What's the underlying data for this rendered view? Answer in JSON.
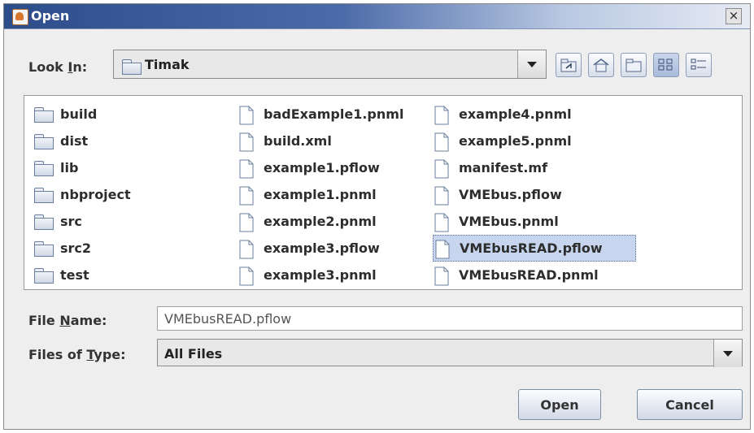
{
  "window": {
    "title": "Open",
    "close_glyph": "×"
  },
  "lookin": {
    "label_prefix": "Look ",
    "label_mnemonic": "I",
    "label_suffix": "n:",
    "value": "Timak",
    "icon": "folder-icon"
  },
  "toolbar": {
    "buttons": [
      {
        "name": "up-one-level-icon"
      },
      {
        "name": "home-icon"
      },
      {
        "name": "new-folder-icon"
      },
      {
        "name": "list-view-icon",
        "pressed": true
      },
      {
        "name": "details-view-icon"
      }
    ]
  },
  "files": {
    "col1": [
      {
        "name": "build",
        "type": "folder"
      },
      {
        "name": "dist",
        "type": "folder"
      },
      {
        "name": "lib",
        "type": "folder"
      },
      {
        "name": "nbproject",
        "type": "folder"
      },
      {
        "name": "src",
        "type": "folder"
      },
      {
        "name": "src2",
        "type": "folder"
      },
      {
        "name": "test",
        "type": "folder"
      }
    ],
    "col2": [
      {
        "name": "badExample1.pnml",
        "type": "file"
      },
      {
        "name": "build.xml",
        "type": "file"
      },
      {
        "name": "example1.pflow",
        "type": "file"
      },
      {
        "name": "example1.pnml",
        "type": "file"
      },
      {
        "name": "example2.pnml",
        "type": "file"
      },
      {
        "name": "example3.pflow",
        "type": "file"
      },
      {
        "name": "example3.pnml",
        "type": "file"
      }
    ],
    "col3": [
      {
        "name": "example4.pnml",
        "type": "file"
      },
      {
        "name": "example5.pnml",
        "type": "file"
      },
      {
        "name": "manifest.mf",
        "type": "file"
      },
      {
        "name": "VMEbus.pflow",
        "type": "file"
      },
      {
        "name": "VMEbus.pnml",
        "type": "file"
      },
      {
        "name": "VMEbusREAD.pflow",
        "type": "file",
        "selected": true
      },
      {
        "name": "VMEbusREAD.pnml",
        "type": "file"
      }
    ]
  },
  "filename": {
    "label_prefix": "File ",
    "label_mnemonic": "N",
    "label_suffix": "ame:",
    "value": "VMEbusREAD.pflow"
  },
  "filetype": {
    "label_prefix": "Files of ",
    "label_mnemonic": "T",
    "label_suffix": "ype:",
    "value": "All Files"
  },
  "buttons": {
    "open": "Open",
    "cancel": "Cancel"
  },
  "colors": {
    "selection": "#c7d6ee",
    "title_gradient_start": "#2c4c8a"
  }
}
